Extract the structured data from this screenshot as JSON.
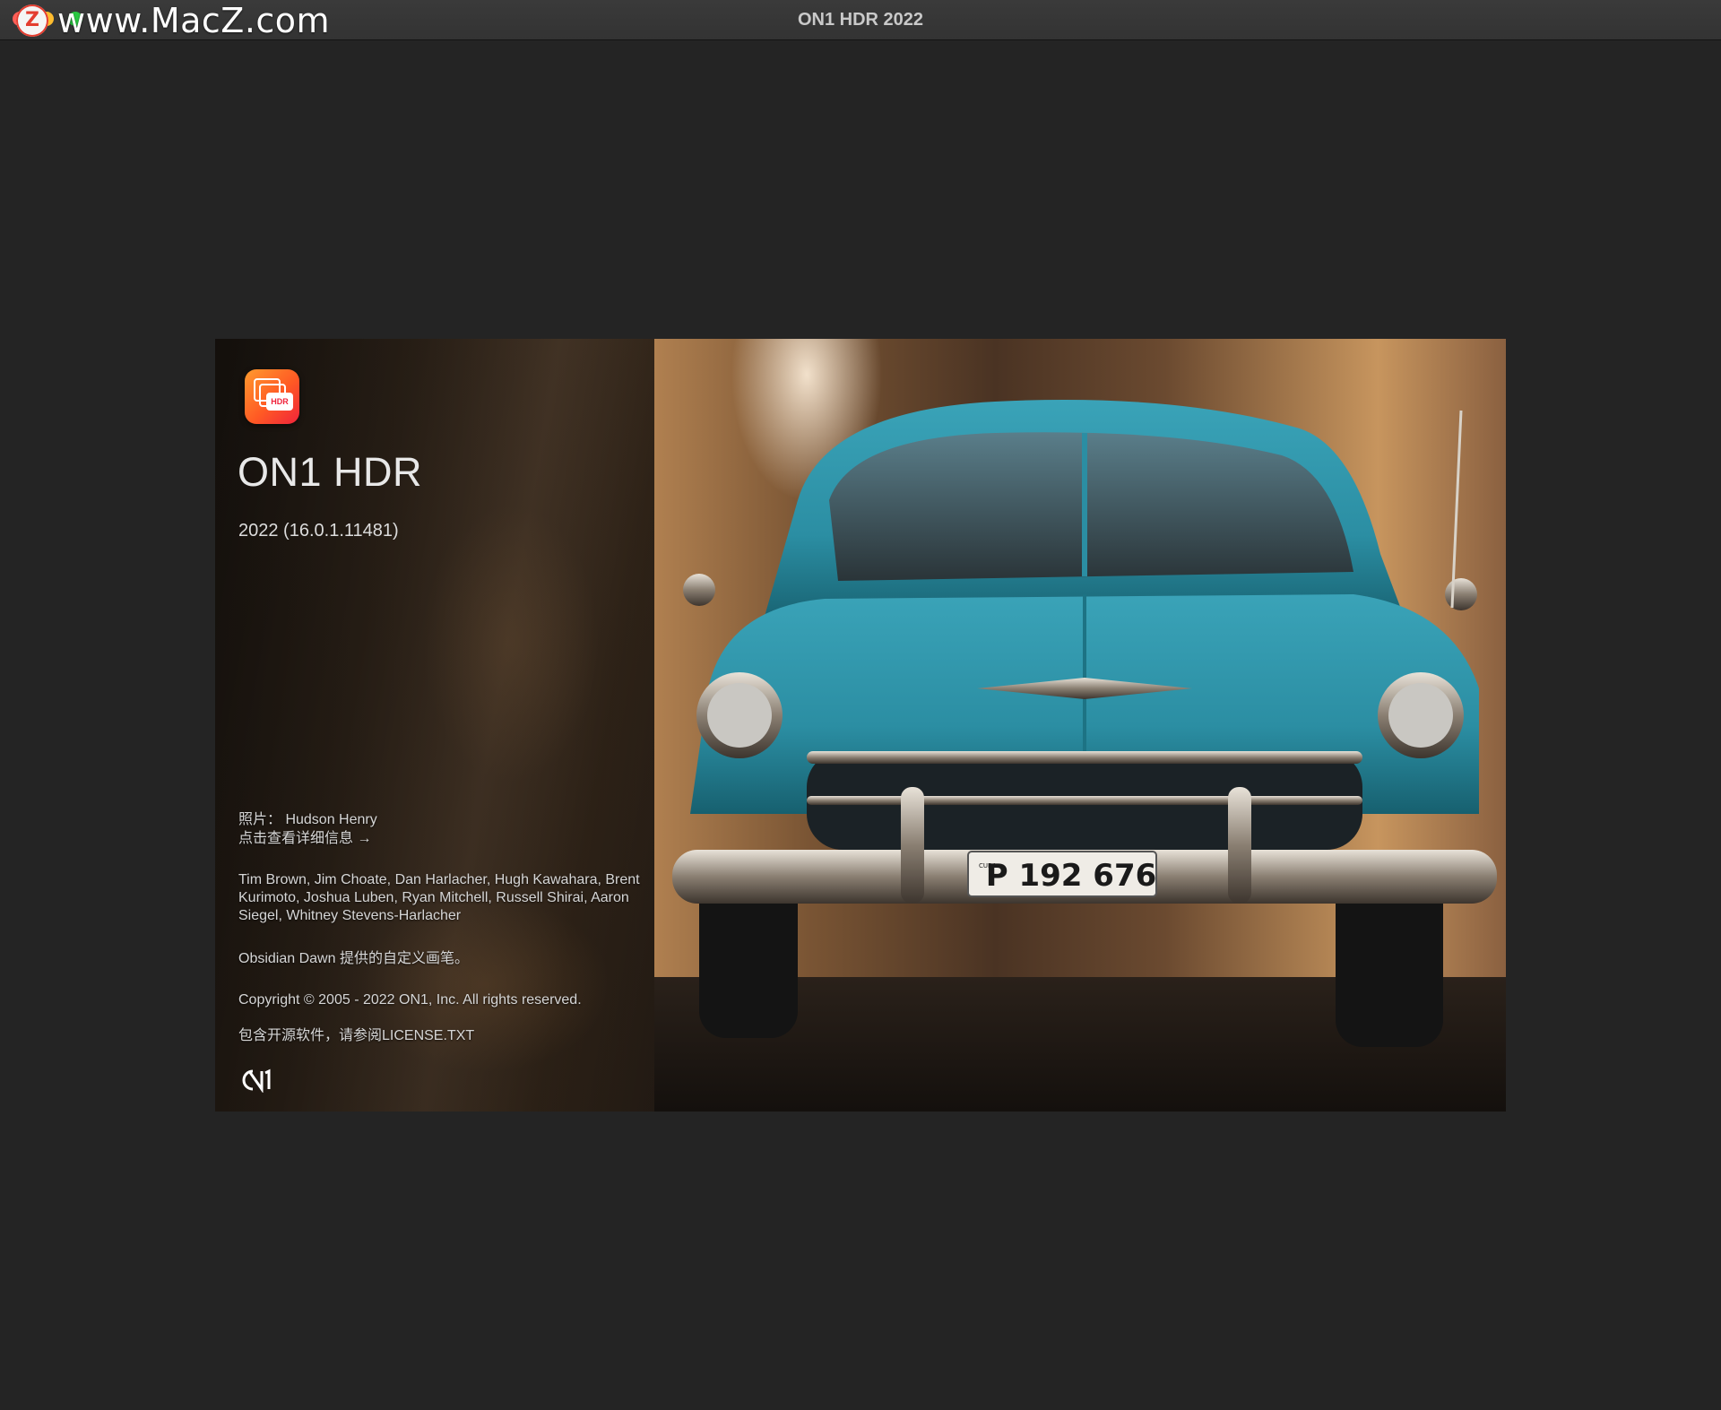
{
  "window": {
    "title": "ON1 HDR 2022",
    "watermark": {
      "logo_letter": "Z",
      "text": "www.MacZ.com"
    }
  },
  "splash": {
    "app_name": "ON1 HDR",
    "version": "2022 (16.0.1.11481)",
    "photo_credit": "照片： Hudson Henry",
    "details_link": "点击查看详细信息 →",
    "team": "Tim Brown, Jim Choate, Dan Harlacher, Hugh Kawahara, Brent Kurimoto, Joshua Luben, Ryan Mitchell, Russell Shirai, Aaron Siegel, Whitney Stevens-Harlacher",
    "brushes_credit": "Obsidian Dawn 提供的自定义画笔。",
    "copyright": "Copyright © 2005 - 2022 ON1, Inc. All rights reserved.",
    "license_note": "包含开源软件，请参阅LICENSE.TXT",
    "icon_badge": "HDR",
    "plate": "P 192 676",
    "plate_side": "CUBA"
  },
  "colors": {
    "background": "#242424",
    "accent_orange": "#ff5a24",
    "car_teal": "#2b8ea3"
  }
}
